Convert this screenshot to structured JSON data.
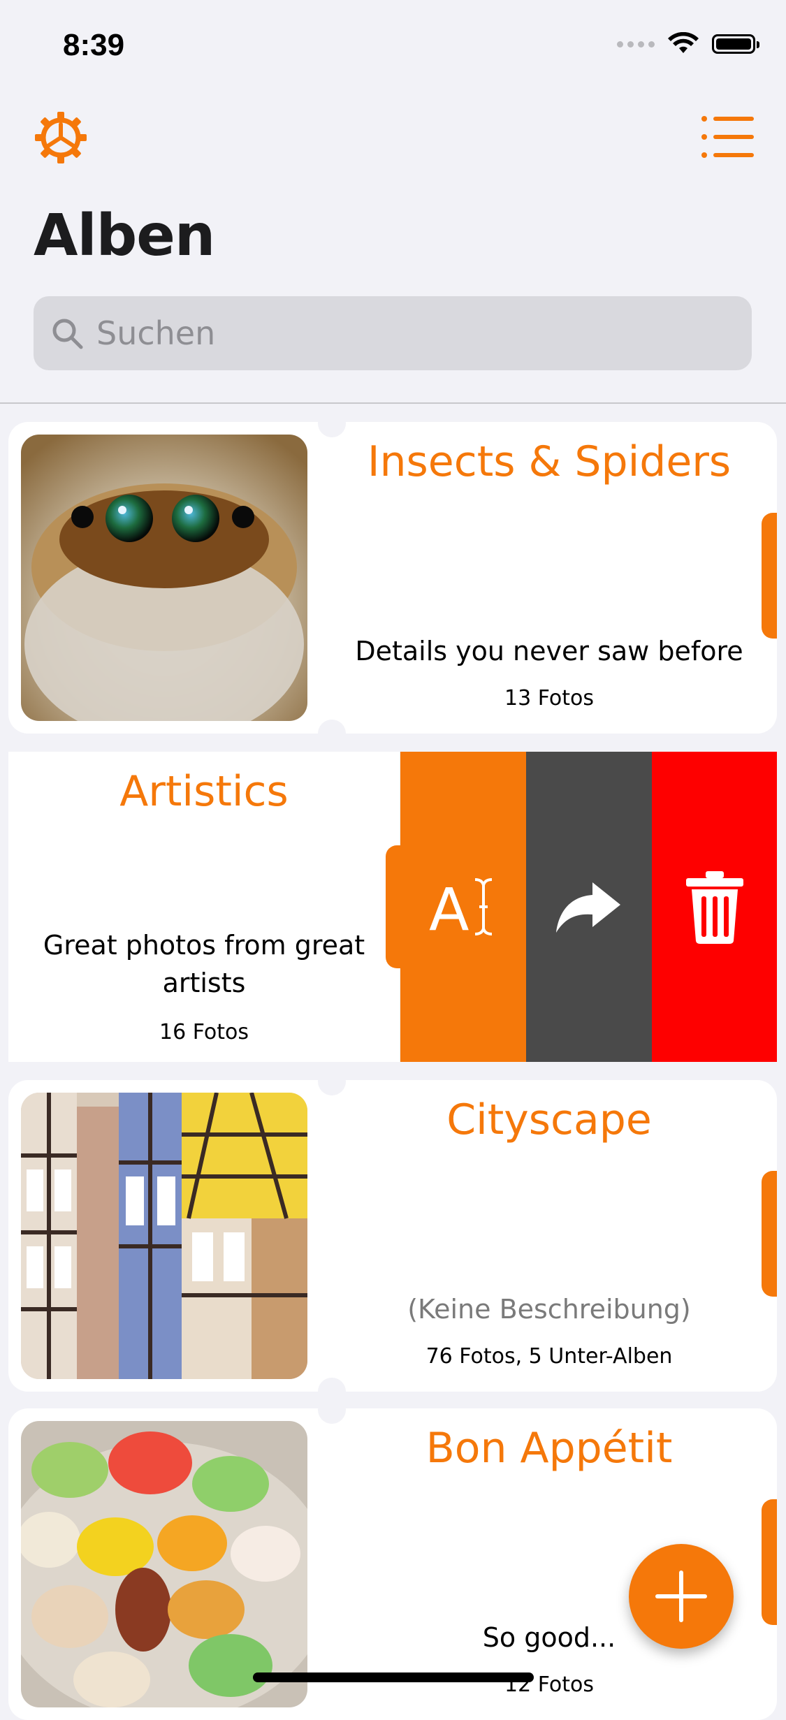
{
  "status_bar": {
    "time": "8:39"
  },
  "header": {
    "title": "Alben"
  },
  "search": {
    "placeholder": "Suchen"
  },
  "albums": [
    {
      "title": "Insects & Spiders",
      "description": "Details you never saw before",
      "count": "13 Fotos"
    },
    {
      "title": "Artistics",
      "description": "Great photos from great artists",
      "count": "16 Fotos"
    },
    {
      "title": "Cityscape",
      "description": "(Keine Beschreibung)",
      "count": "76 Fotos, 5 Unter-Alben"
    },
    {
      "title": "Bon Appétit",
      "description": "So good...",
      "count": "12 Fotos"
    }
  ],
  "actions": {
    "rename_icon": "rename-icon",
    "share_icon": "share-icon",
    "delete_icon": "trash-icon"
  },
  "colors": {
    "accent": "#f5780a",
    "share": "#4a4a4a",
    "delete": "#fe0000"
  }
}
